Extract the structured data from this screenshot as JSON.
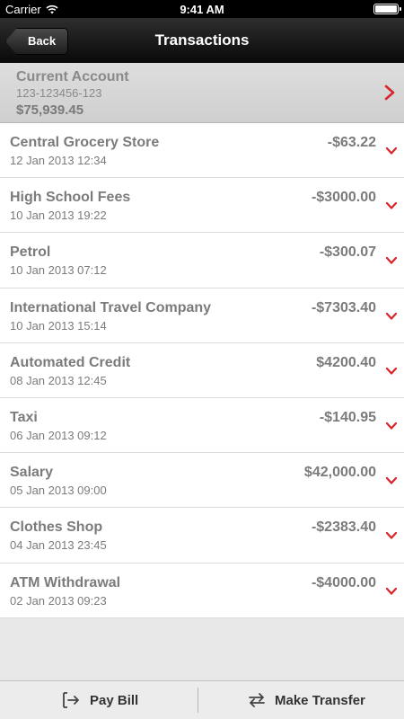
{
  "status_bar": {
    "carrier": "Carrier",
    "time": "9:41 AM"
  },
  "nav": {
    "back_label": "Back",
    "title": "Transactions"
  },
  "account": {
    "name": "Current Account",
    "number": "123-123456-123",
    "balance": "$75,939.45"
  },
  "transactions": [
    {
      "name": "Central Grocery Store",
      "date": "12 Jan 2013 12:34",
      "amount": "-$63.22"
    },
    {
      "name": "High School Fees",
      "date": "10 Jan 2013 19:22",
      "amount": "-$3000.00"
    },
    {
      "name": "Petrol",
      "date": "10 Jan 2013 07:12",
      "amount": "-$300.07"
    },
    {
      "name": "International Travel Company",
      "date": "10 Jan 2013 15:14",
      "amount": "-$7303.40"
    },
    {
      "name": "Automated Credit",
      "date": "08 Jan 2013 12:45",
      "amount": "$4200.40"
    },
    {
      "name": "Taxi",
      "date": "06 Jan 2013 09:12",
      "amount": "-$140.95"
    },
    {
      "name": "Salary",
      "date": "05 Jan 2013 09:00",
      "amount": "$42,000.00"
    },
    {
      "name": "Clothes Shop",
      "date": "04 Jan 2013 23:45",
      "amount": "-$2383.40"
    },
    {
      "name": "ATM Withdrawal",
      "date": "02 Jan 2013 09:23",
      "amount": "-$4000.00"
    }
  ],
  "toolbar": {
    "pay_bill_label": "Pay Bill",
    "make_transfer_label": "Make Transfer"
  },
  "colors": {
    "accent": "#d9252a",
    "nav_background": "#111111",
    "text_gray": "#7b7b7b"
  },
  "icons": {
    "status": [
      "wifi-icon",
      "battery-icon"
    ],
    "row": "chevron-down-icon",
    "account": "chevron-right-icon",
    "toolbar": [
      "pay-bill-icon",
      "transfer-icon"
    ]
  }
}
